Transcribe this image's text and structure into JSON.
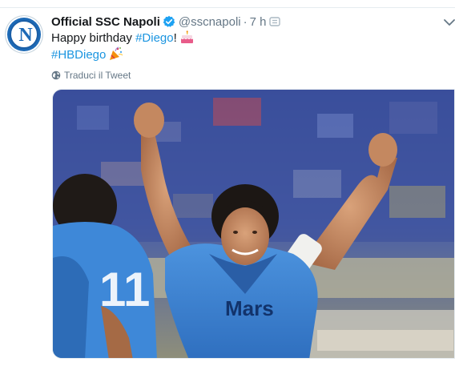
{
  "tweet": {
    "author_name": "Official SSC Napoli",
    "handle": "@sscnapoli",
    "separator": "·",
    "time": "7 h",
    "text_line1_prefix": "Happy birthday",
    "text_line1_hashtag": "#Diego",
    "text_line1_suffix": "!",
    "text_line2_hashtag": "#HBDiego",
    "translate_label": "Traduci il Tweet",
    "avatar_letter": "N",
    "shirt_sponsor": "Mars"
  },
  "icons": {
    "verified": "verified-badge-icon",
    "menu": "menu-icon",
    "caret": "chevron-down-icon",
    "cake": "birthday-cake-emoji",
    "party": "party-popper-emoji",
    "globe": "globe-icon"
  },
  "colors": {
    "link": "#1b95e0",
    "verified": "#1da1f2",
    "secondary_text": "#657786",
    "napoli_blue": "#1d6ab6",
    "shirt_blue": "#3f86d3"
  }
}
